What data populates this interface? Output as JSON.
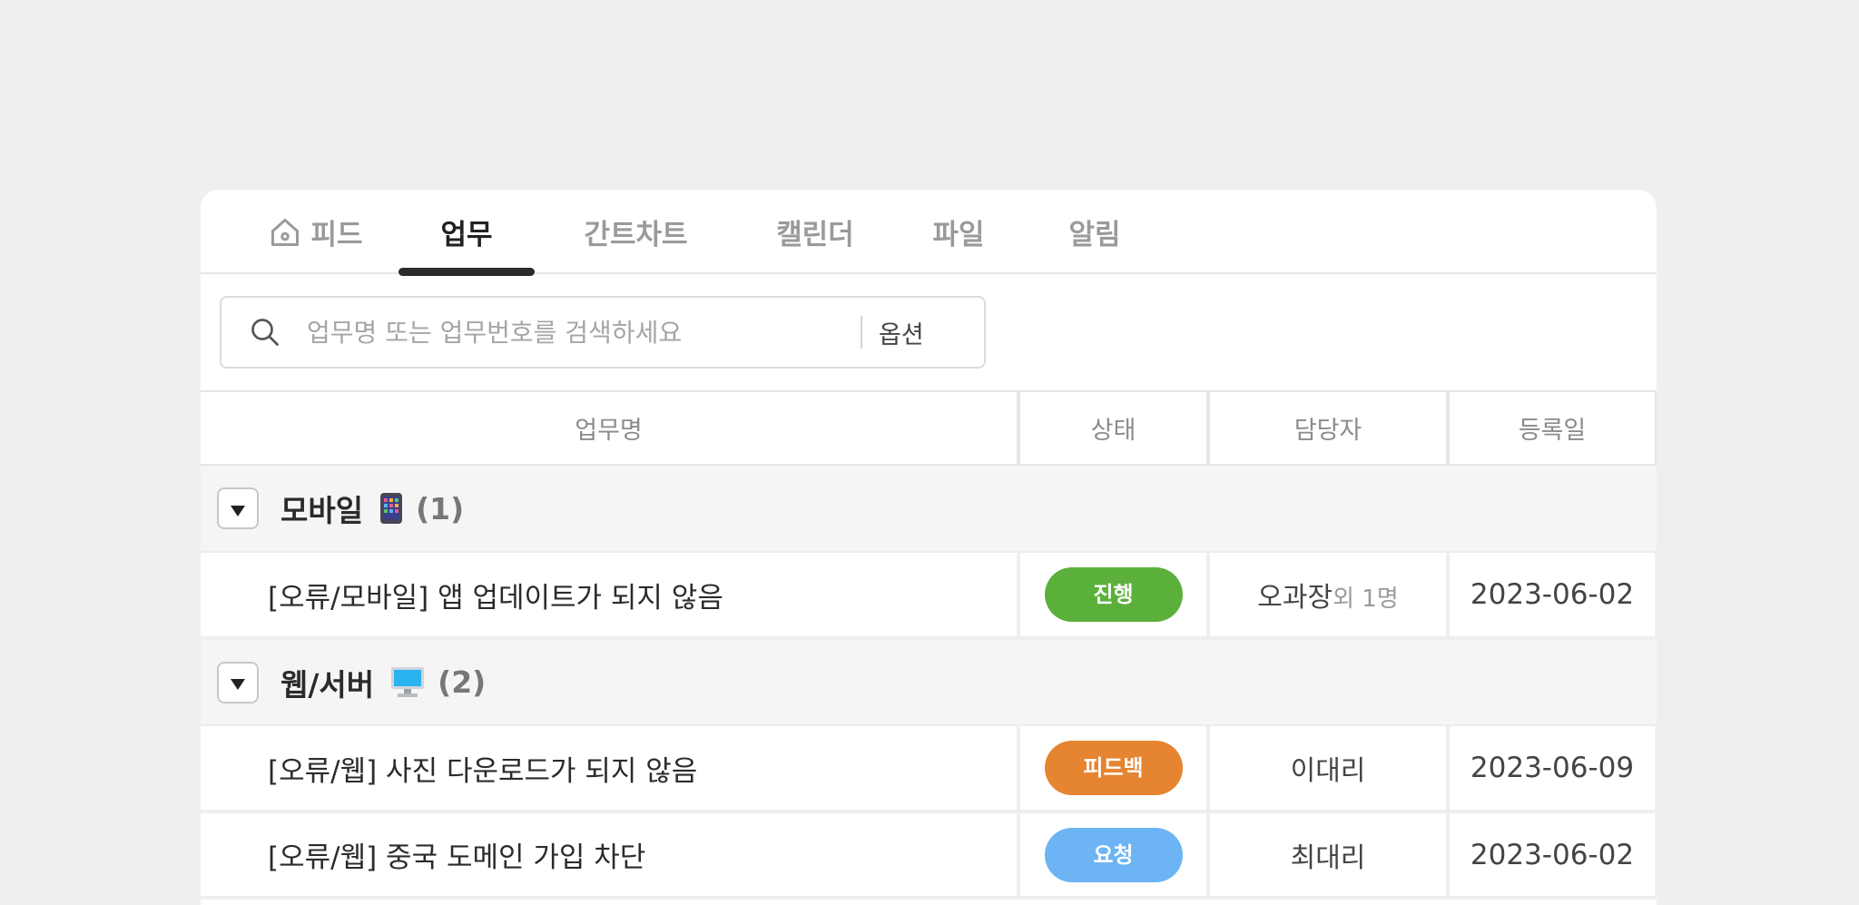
{
  "tabs": [
    {
      "label": "피드",
      "icon": "home-icon",
      "active": false
    },
    {
      "label": "업무",
      "active": true
    },
    {
      "label": "간트차트",
      "active": false
    },
    {
      "label": "캘린더",
      "active": false
    },
    {
      "label": "파일",
      "active": false
    },
    {
      "label": "알림",
      "active": false
    }
  ],
  "search": {
    "placeholder": "업무명 또는 업무번호를 검색하세요",
    "value": "",
    "option_label": "옵션"
  },
  "table": {
    "columns": [
      "업무명",
      "상태",
      "담당자",
      "등록일"
    ],
    "groups": [
      {
        "name": "모바일",
        "emoji": "mobile-phone-icon",
        "count": "(1)",
        "rows": [
          {
            "title": "[오류/모바일] 앱 업데이트가 되지 않음",
            "status": "진행",
            "assignee": "오과장",
            "assignee_extra": "외 1명",
            "date": "2023-06-02"
          }
        ]
      },
      {
        "name": "웹/서버",
        "emoji": "desktop-computer-icon",
        "count": "(2)",
        "rows": [
          {
            "title": "[오류/웹] 사진 다운로드가 되지 않음",
            "status": "피드백",
            "assignee": "이대리",
            "assignee_extra": "",
            "date": "2023-06-09"
          },
          {
            "title": "[오류/웹] 중국 도메인 가입 차단",
            "status": "요청",
            "assignee": "최대리",
            "assignee_extra": "",
            "date": "2023-06-02"
          }
        ]
      }
    ]
  },
  "colors": {
    "status_progress": "#5bb03b",
    "status_feedback": "#e58431",
    "status_request": "#6cb4f4"
  }
}
